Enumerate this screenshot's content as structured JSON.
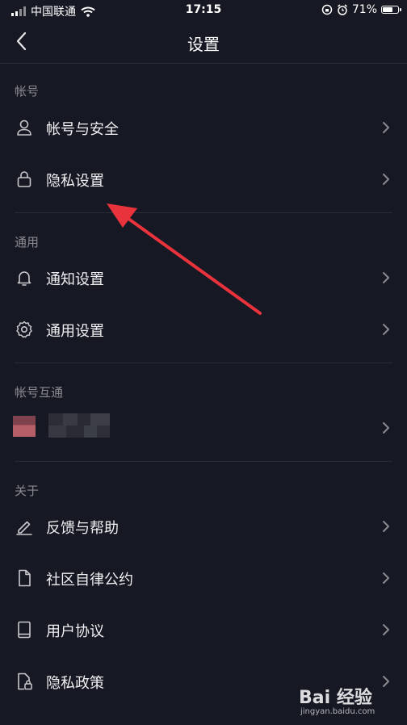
{
  "status_bar": {
    "carrier": "中国联通",
    "time": "17:15",
    "battery": "71%",
    "battery_level": 0.71
  },
  "nav": {
    "title": "设置"
  },
  "sections": {
    "account": {
      "title": "帐号",
      "items": [
        {
          "label": "帐号与安全",
          "icon": "user-icon"
        },
        {
          "label": "隐私设置",
          "icon": "lock-icon"
        }
      ]
    },
    "general": {
      "title": "通用",
      "items": [
        {
          "label": "通知设置",
          "icon": "bell-icon"
        },
        {
          "label": "通用设置",
          "icon": "gear-icon"
        }
      ]
    },
    "linked": {
      "title": "帐号互通"
    },
    "about": {
      "title": "关于",
      "items": [
        {
          "label": "反馈与帮助",
          "icon": "pencil-icon"
        },
        {
          "label": "社区自律公约",
          "icon": "document-icon"
        },
        {
          "label": "用户协议",
          "icon": "book-icon"
        },
        {
          "label": "隐私政策",
          "icon": "document-lock-icon"
        }
      ]
    }
  },
  "watermark": {
    "logo": "Bai 经验",
    "url": "jingyan.baidu.com"
  },
  "colors": {
    "background": "#161823",
    "arrow": "#e8323c",
    "divider": "#2a2c36"
  }
}
